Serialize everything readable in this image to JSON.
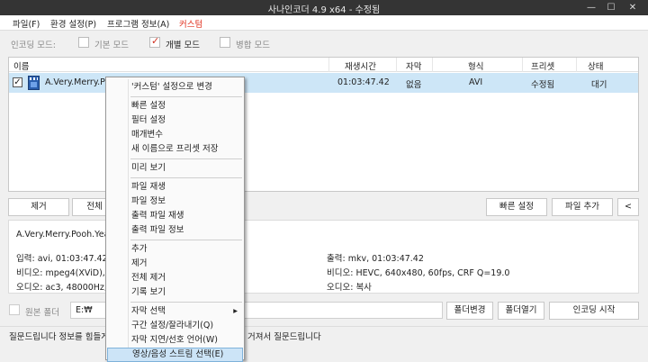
{
  "title": "사나인코더 4.9 x64 - 수정됨",
  "window_buttons": {
    "min": "—",
    "max": "☐",
    "close": "✕"
  },
  "menu": [
    {
      "label": "파일(F)"
    },
    {
      "label": "환경 설정(P)"
    },
    {
      "label": "프로그램 정보(A)"
    },
    {
      "label": "커스텀",
      "color": "#e0301e"
    }
  ],
  "mode": {
    "label": "인코딩 모드:",
    "options": [
      {
        "label": "기본 모드",
        "checked": false
      },
      {
        "label": "개별 모드",
        "checked": true
      },
      {
        "label": "병합 모드",
        "checked": false
      }
    ]
  },
  "list": {
    "headers": [
      "이름",
      "재생시간",
      "자막",
      "형식",
      "프리셋",
      "상태"
    ],
    "row": {
      "checked": true,
      "name": "A.Very.Merry.Poo",
      "duration": "01:03:47.42",
      "subtitle": "없음",
      "format": "AVI",
      "preset": "수정됨",
      "status": "대기"
    }
  },
  "buttons": {
    "remove": "제거",
    "all": "전체",
    "quick": "빠른 설정",
    "add_file": "파일 추가",
    "collapse": "<"
  },
  "info": {
    "filename": "A.Very.Merry.Pooh.Year.2",
    "input": "입력: avi, 01:03:47.42, 1.3",
    "video_in": "비디오: mpeg4(XViD), 64",
    "audio_in": "오디오: ac3, 48000Hz, 2c",
    "output": "출력: mkv, 01:03:47.42",
    "video_out": "비디오: HEVC, 640x480, 60fps, CRF Q=19.0",
    "audio_out": "오디오: 복사"
  },
  "folder": {
    "label": "원본 폴더",
    "path": "E:₩",
    "change": "폴더변경",
    "open": "폴더열기",
    "start": "인코딩 시작"
  },
  "status_text": "질문드립니다 정보를 힘들게",
  "status_text_right": "거져서 질문드립니다",
  "context_menu": [
    {
      "label": "'커스텀' 설정으로 변경"
    },
    {
      "sep": true
    },
    {
      "label": "빠른 설정"
    },
    {
      "label": "필터 설정"
    },
    {
      "label": "매개변수"
    },
    {
      "label": "새 이름으로 프리셋 저장"
    },
    {
      "sep": true
    },
    {
      "label": "미리 보기"
    },
    {
      "sep": true
    },
    {
      "label": "파일 재생"
    },
    {
      "label": "파일 정보"
    },
    {
      "label": "출력 파일 재생"
    },
    {
      "label": "출력 파일 정보"
    },
    {
      "sep": true
    },
    {
      "label": "추가"
    },
    {
      "label": "제거"
    },
    {
      "label": "전체 제거"
    },
    {
      "label": "기록 보기"
    },
    {
      "sep": true
    },
    {
      "label": "자막 선택",
      "submenu": true
    },
    {
      "label": "구간 설정/잘라내기(Q)"
    },
    {
      "label": "자막 지연/선호 언어(W)"
    },
    {
      "label": "영상/음성 스트림 선택(E)",
      "highlighted": true
    }
  ]
}
